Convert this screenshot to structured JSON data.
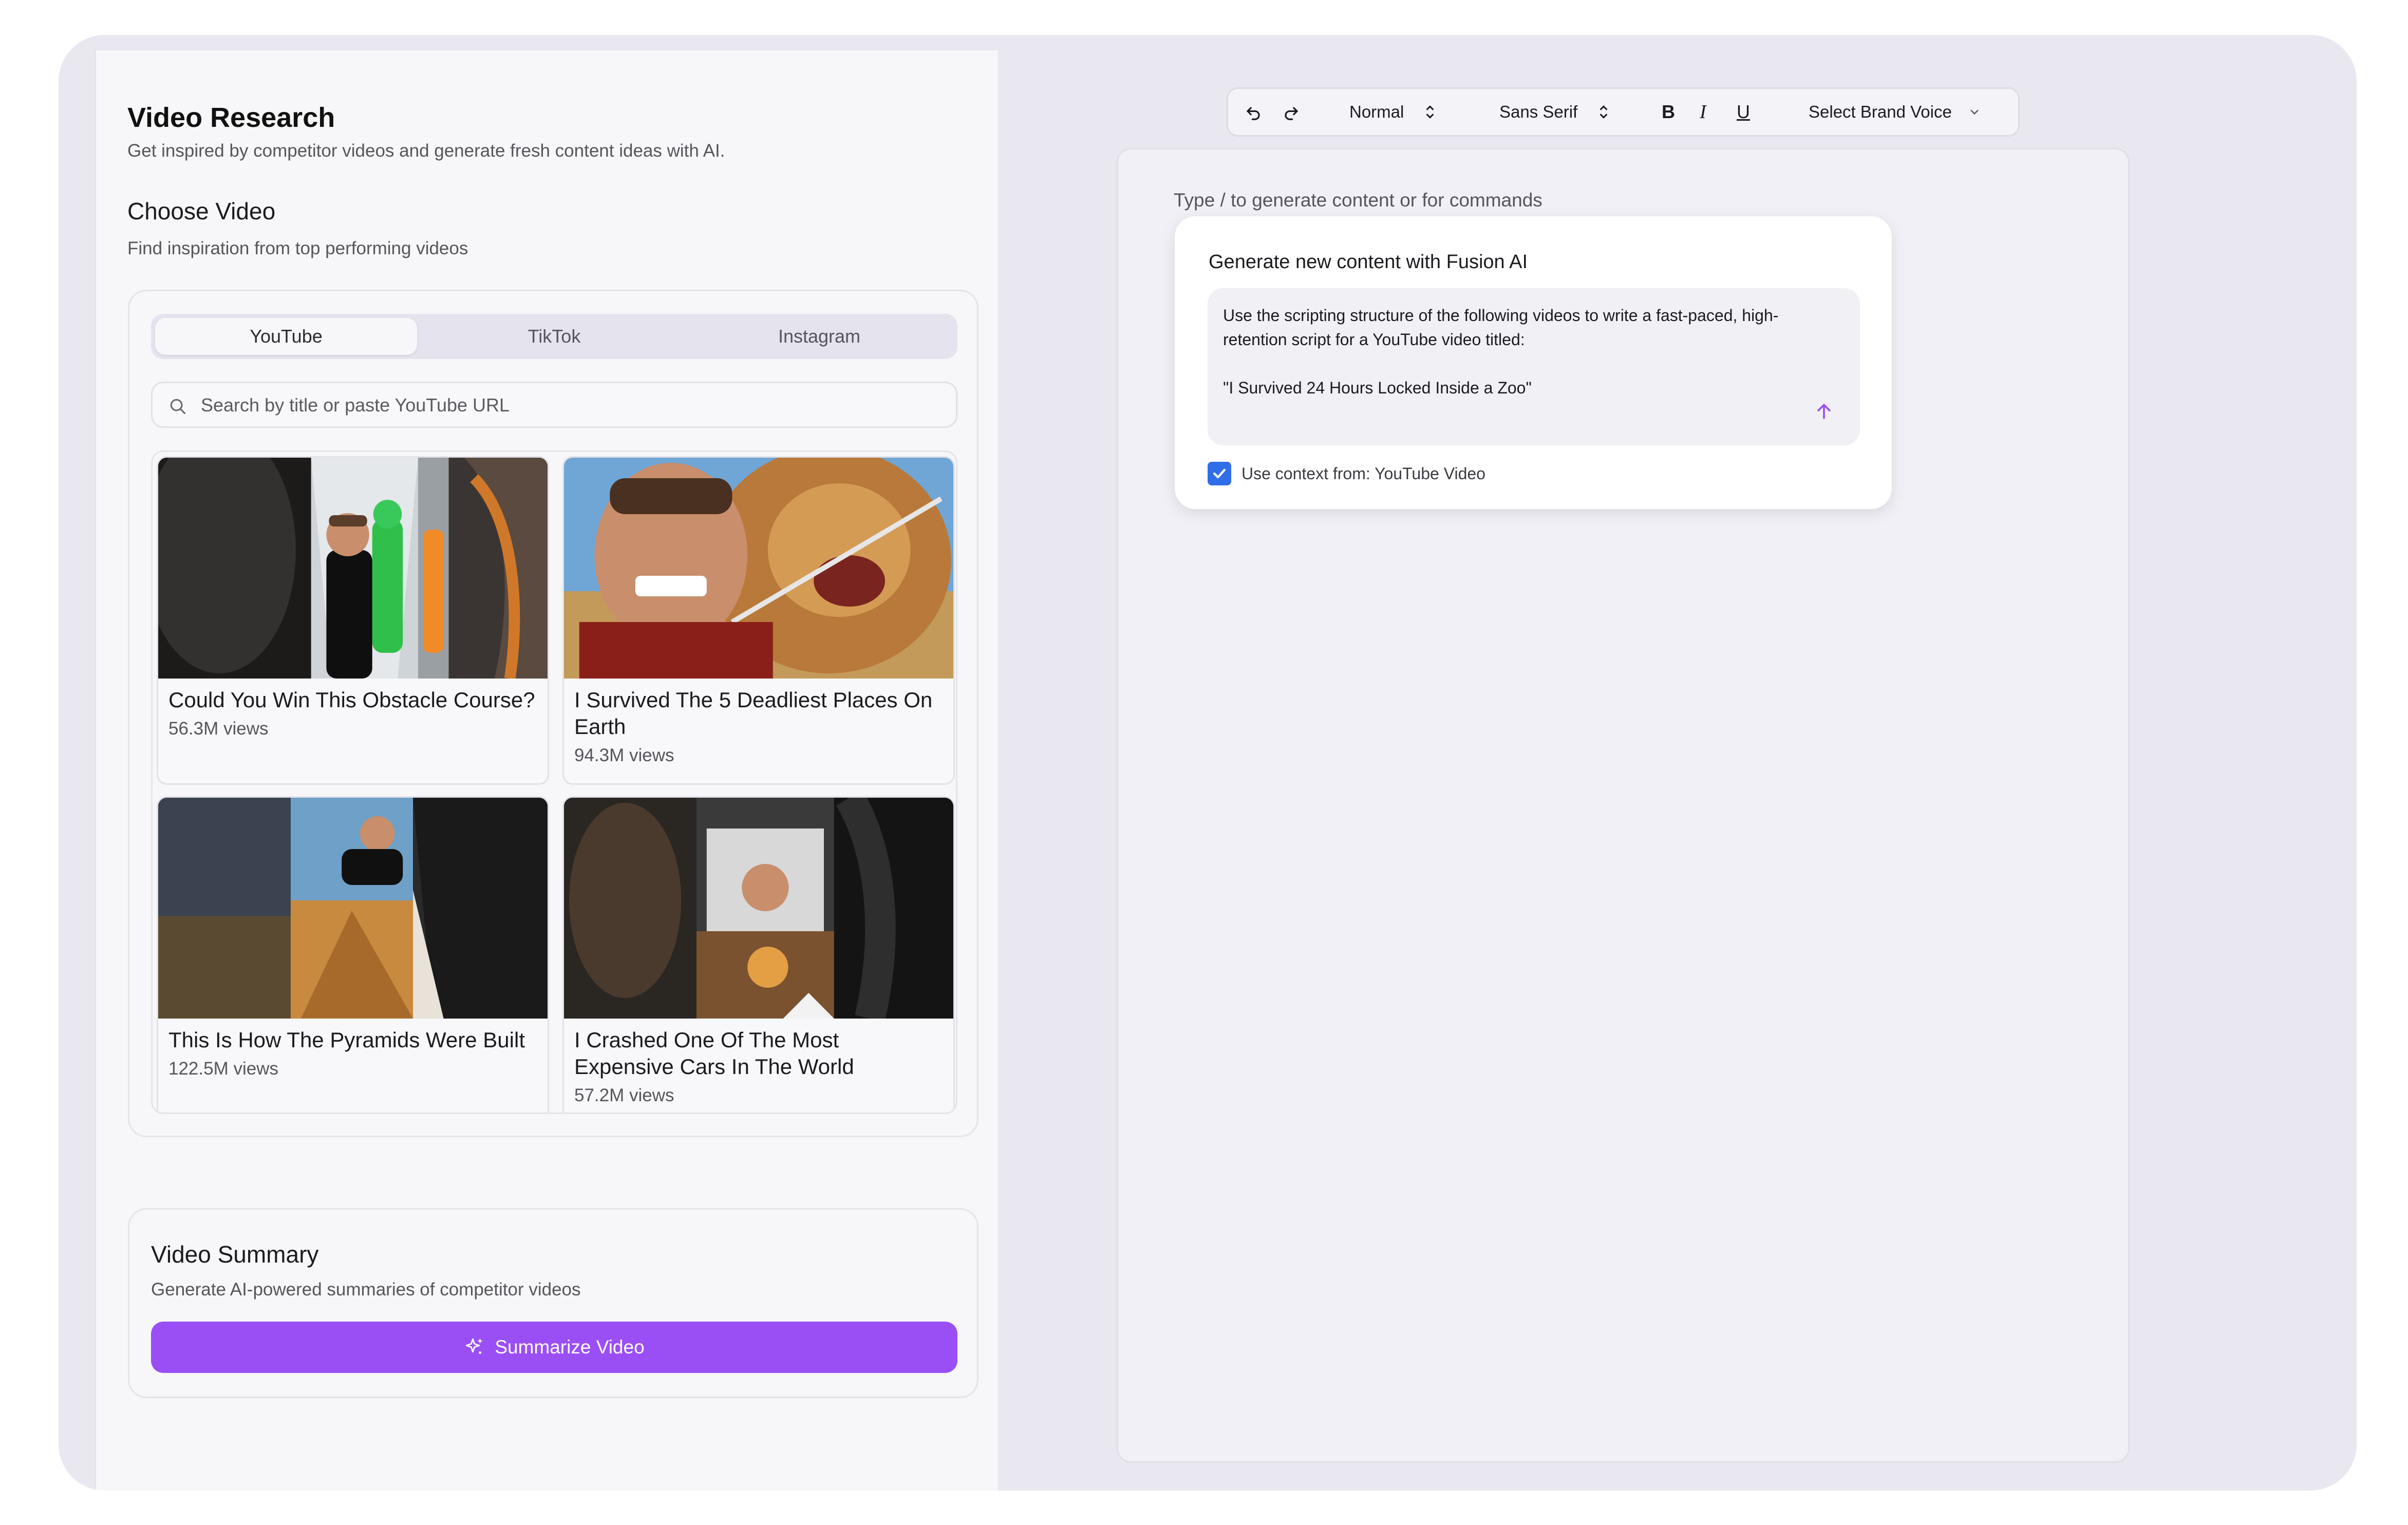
{
  "header": {
    "title": "Video Research",
    "subtitle": "Get inspired by competitor videos and generate fresh content ideas with AI."
  },
  "choose_video": {
    "title": "Choose Video",
    "subtitle": "Find inspiration from top performing videos",
    "tabs": [
      {
        "label": "YouTube",
        "active": true
      },
      {
        "label": "TikTok",
        "active": false
      },
      {
        "label": "Instagram",
        "active": false
      }
    ],
    "search": {
      "placeholder": "Search by title or paste YouTube URL",
      "value": ""
    },
    "videos": [
      {
        "title": "Could You Win This Obstacle Course?",
        "views": "56.3M views",
        "thumbnail": "obstacle-course-thumbnail"
      },
      {
        "title": "I Survived The 5 Deadliest Places On Earth",
        "views": "94.3M views",
        "thumbnail": "lion-thumbnail"
      },
      {
        "title": "This Is How The Pyramids Were Built",
        "views": "122.5M views",
        "thumbnail": "pyramids-thumbnail"
      },
      {
        "title": "I Crashed One Of The Most Expensive Cars In The World",
        "views": "57.2M views",
        "thumbnail": "car-crash-thumbnail"
      }
    ]
  },
  "summary": {
    "title": "Video Summary",
    "subtitle": "Generate AI-powered summaries of competitor videos",
    "button": "Summarize Video"
  },
  "toolbar": {
    "undo_icon": "undo-icon",
    "redo_icon": "redo-icon",
    "text_style": "Normal",
    "font": "Sans Serif",
    "bold": "B",
    "italic": "I",
    "underline": "U",
    "brand_voice": "Select Brand Voice"
  },
  "editor": {
    "hint": "Type / to generate content or for commands",
    "ai_panel": {
      "title": "Generate new content with Fusion AI",
      "prompt": "Use the scripting structure of the following videos to write a fast-paced, high-retention script for a YouTube video titled:\n\n\"I Survived 24 Hours Locked Inside a Zoo\"",
      "context_checked": true,
      "context_label": "Use context from: YouTube Video"
    }
  },
  "colors": {
    "accent": "#9a4ff5",
    "checkbox": "#2f6ee6",
    "frame_bg": "#e9e8f1",
    "panel_bg": "#f7f7f9"
  }
}
